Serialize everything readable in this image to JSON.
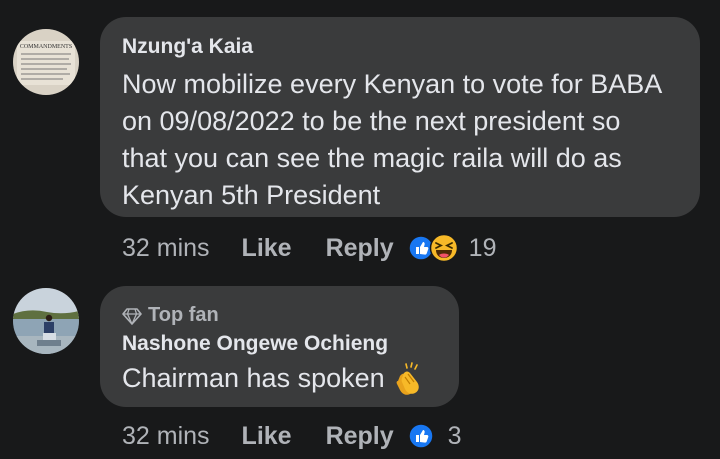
{
  "comments": [
    {
      "author": "Nzung'a Kaia",
      "avatar_icon": "ten-commandments-avatar",
      "avatar_text": "COMMANDMENTS",
      "text_lines": [
        "Now mobilize every Kenyan to vote for BABA",
        "on 09/08/2022 to be the next president so",
        "that you can see the magic raila will do as",
        "Kenyan 5th President"
      ],
      "time": "32 mins",
      "like_label": "Like",
      "reply_label": "Reply",
      "reactions": [
        "like-icon",
        "laughing-emoji-icon"
      ],
      "reaction_count": "19"
    },
    {
      "badge_icon": "diamond-icon",
      "badge": "Top fan",
      "author": "Nashone Ongewe Ochieng",
      "avatar_icon": "lakeside-person-avatar",
      "text_lines": [
        "Chairman has spoken"
      ],
      "text_emoji": "clapping-hands-emoji",
      "time": "32 mins",
      "like_label": "Like",
      "reply_label": "Reply",
      "reactions": [
        "like-icon"
      ],
      "reaction_count": "3"
    }
  ],
  "colors": {
    "background": "#18191a",
    "bubble": "#3a3b3c",
    "primary_text": "#e4e6eb",
    "secondary_text": "#b0b3b8",
    "like_blue": "#1877f2",
    "emoji_yellow": "#f7b928"
  }
}
